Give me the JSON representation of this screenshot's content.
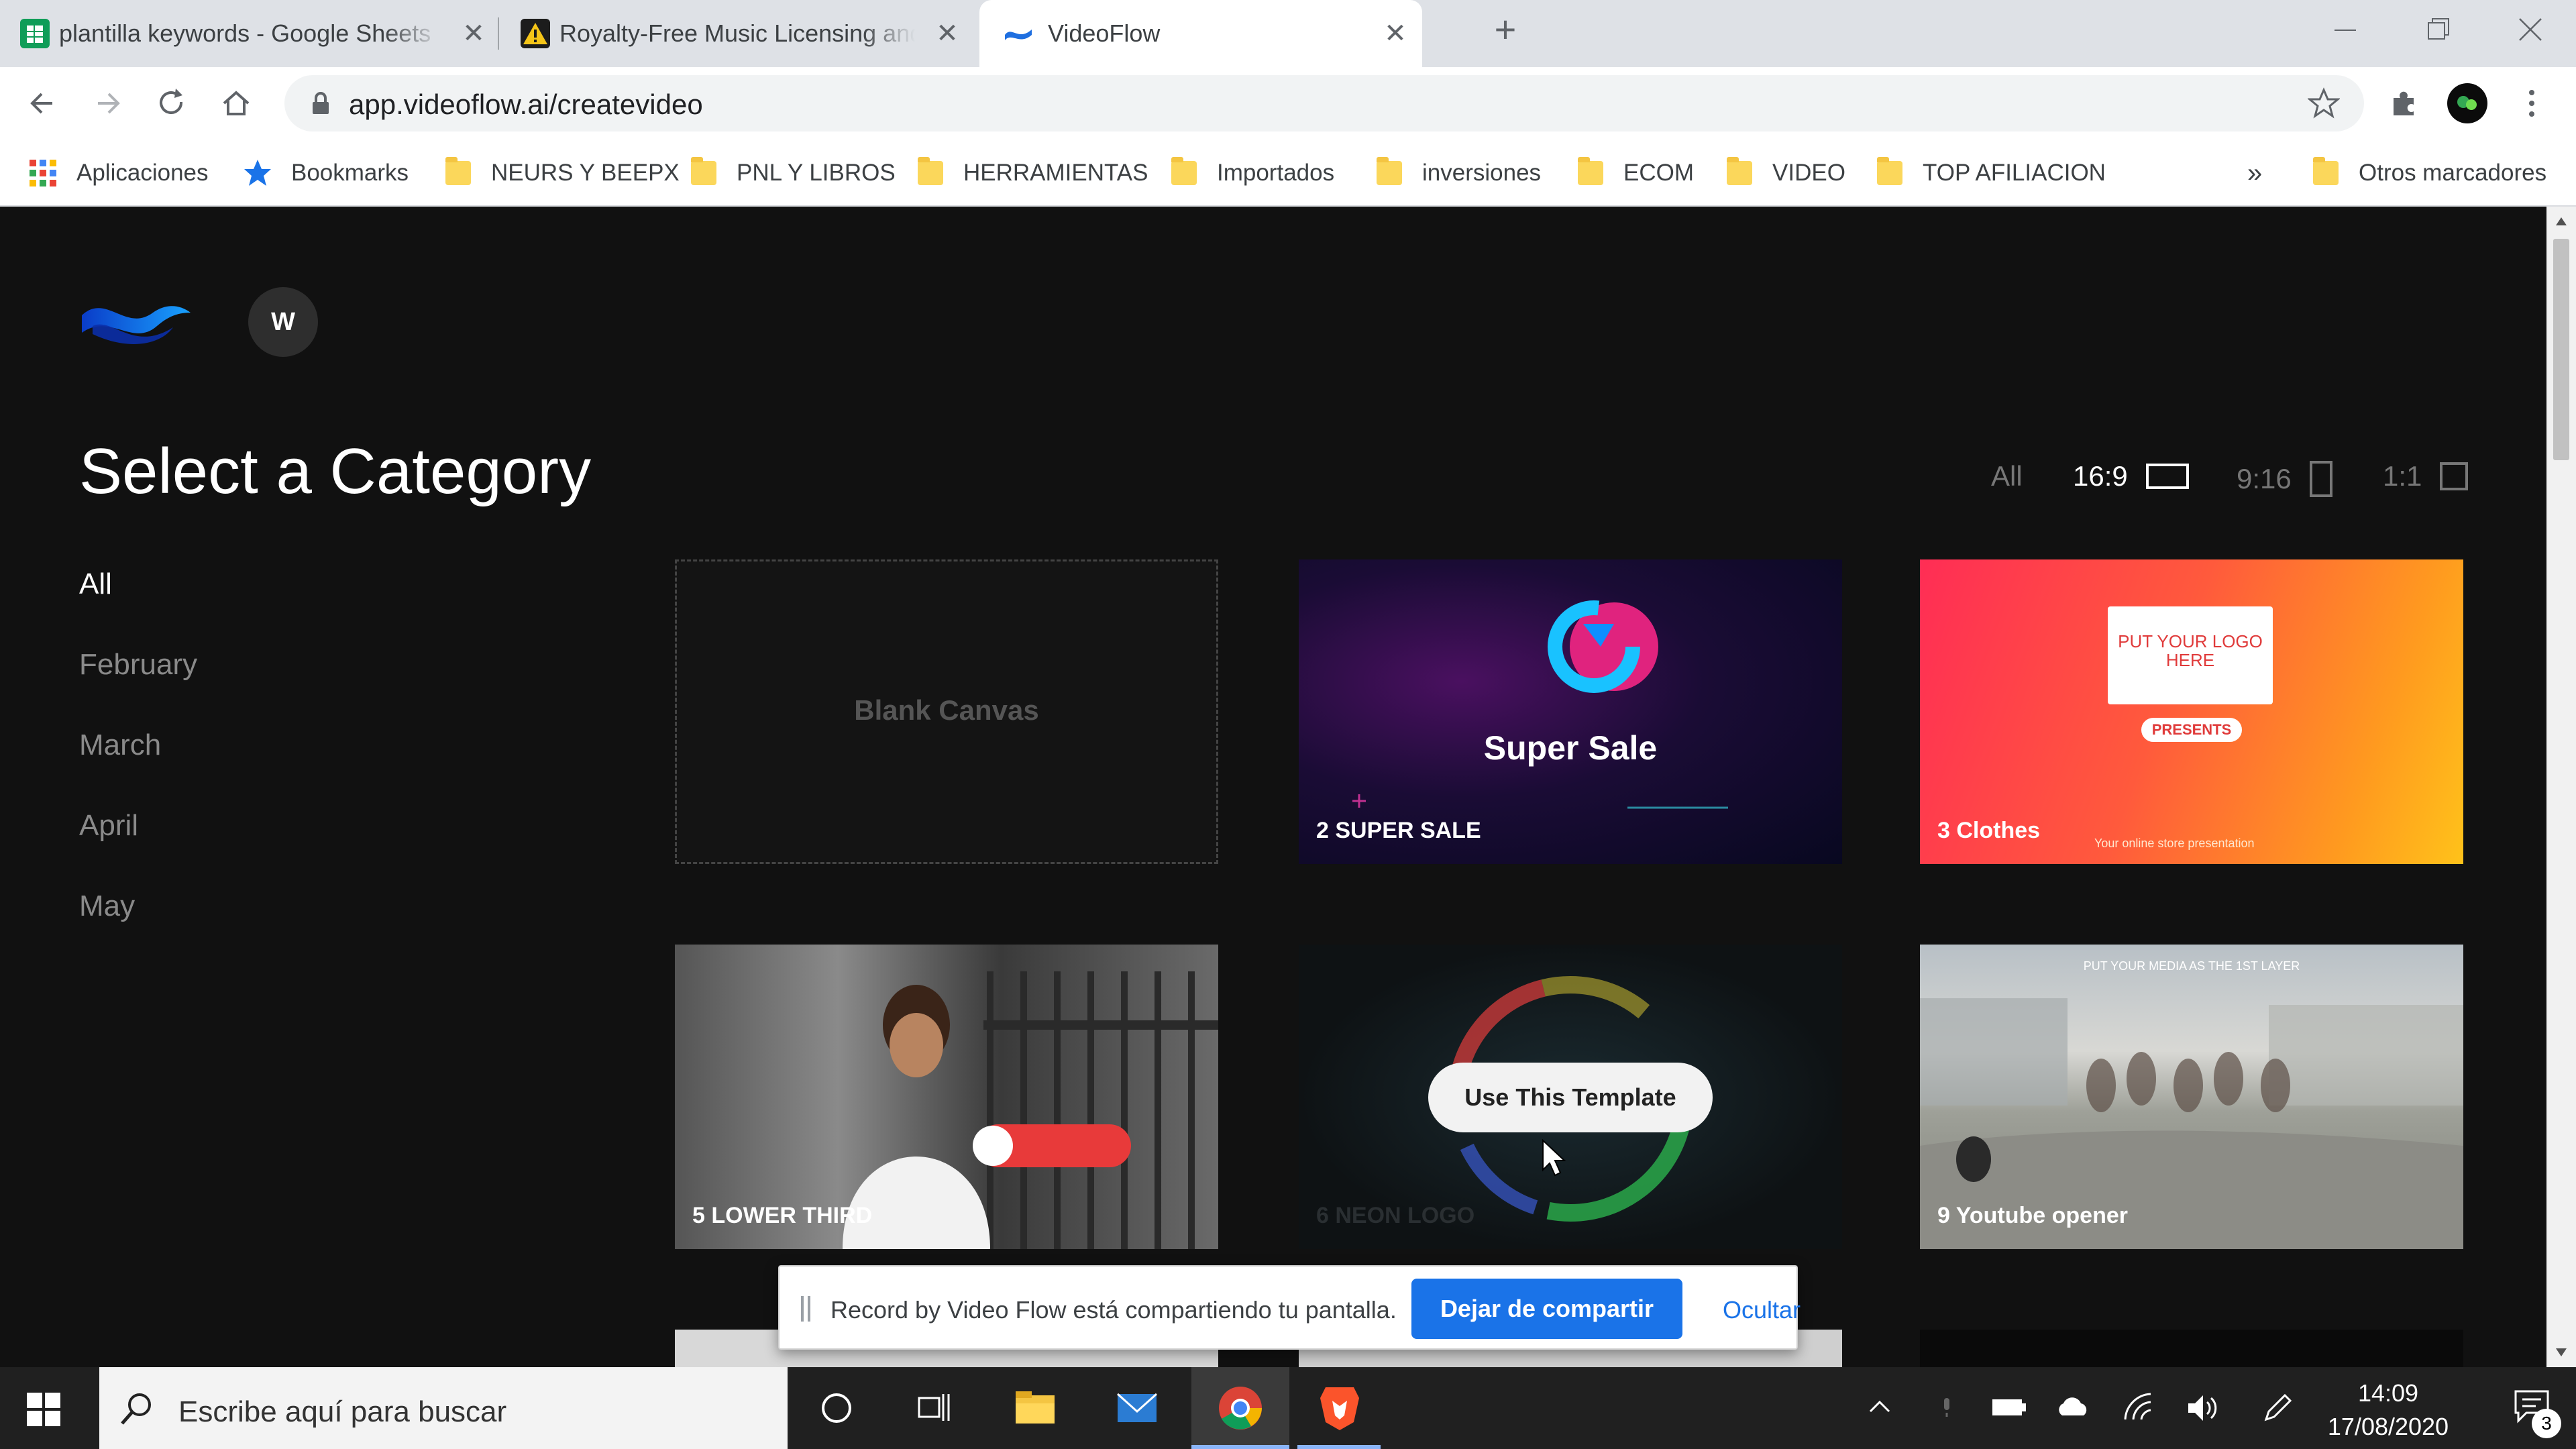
{
  "browser": {
    "tabs": [
      {
        "title": "plantilla keywords - Google Sheets",
        "close": "✕"
      },
      {
        "title": "Royalty-Free Music Licensing and",
        "close": "✕"
      },
      {
        "title": "VideoFlow",
        "close": "✕"
      }
    ],
    "new_tab": "+",
    "url": "app.videoflow.ai/createvideo",
    "bookmarks": [
      {
        "label": "Aplicaciones",
        "icon": "apps-grid-icon"
      },
      {
        "label": "Bookmarks",
        "icon": "star-icon"
      },
      {
        "label": "NEURS Y BEEPX",
        "icon": "folder-icon"
      },
      {
        "label": "PNL Y LIBROS",
        "icon": "folder-icon"
      },
      {
        "label": "HERRAMIENTAS",
        "icon": "folder-icon"
      },
      {
        "label": "Importados",
        "icon": "folder-icon"
      },
      {
        "label": "inversiones",
        "icon": "folder-icon"
      },
      {
        "label": "ECOM",
        "icon": "folder-icon"
      },
      {
        "label": "VIDEO",
        "icon": "folder-icon"
      },
      {
        "label": "TOP AFILIACION",
        "icon": "folder-icon"
      }
    ],
    "more_bookmarks": "»",
    "other_bookmarks": "Otros marcadores"
  },
  "app": {
    "avatar_initial": "W",
    "title": "Select a Category",
    "categories": [
      "All",
      "February",
      "March",
      "April",
      "May"
    ],
    "ratios": [
      "All",
      "16:9",
      "9:16",
      "1:1"
    ],
    "cards": [
      {
        "label": "Blank Canvas"
      },
      {
        "label": "2 SUPER SALE",
        "headline": "Super Sale"
      },
      {
        "label": "3 Clothes",
        "logo_text": "PUT YOUR LOGO HERE",
        "badge": "PRESENTS",
        "sub": "Your online store presentation"
      },
      {
        "label": "5 LOWER THIRD"
      },
      {
        "label": "6 NEON LOGO",
        "hover_button": "Use This Template"
      },
      {
        "label": "9 Youtube opener",
        "overlay": "PUT YOUR MEDIA AS THE 1ST LAYER"
      }
    ]
  },
  "share_bar": {
    "message": "Record by Video Flow está compartiendo tu pantalla.",
    "stop": "Dejar de compartir",
    "hide": "Ocultar"
  },
  "taskbar": {
    "search_placeholder": "Escribe aquí para buscar",
    "time": "14:09",
    "date": "17/08/2020",
    "notifications": "3"
  }
}
